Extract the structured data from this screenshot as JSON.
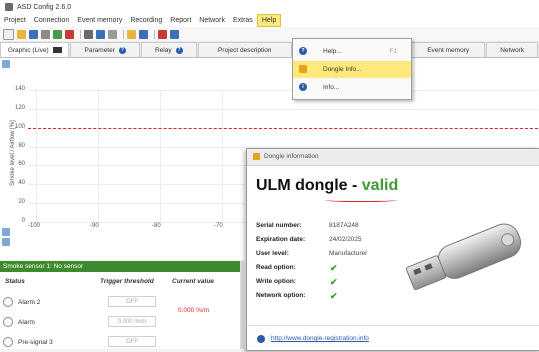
{
  "window": {
    "title": "ASD Config 2.6.0"
  },
  "menu": {
    "items": [
      "Project",
      "Connection",
      "Event memory",
      "Recording",
      "Report",
      "Network",
      "Extras",
      "Help"
    ],
    "active": "Help"
  },
  "tabs": [
    {
      "label": "Graphic (Live)"
    },
    {
      "label": "Parameter"
    },
    {
      "label": "Relay"
    },
    {
      "label": "Project description"
    },
    {
      "label": "Event memory"
    },
    {
      "label": "Network"
    }
  ],
  "help_menu": {
    "items": [
      {
        "label": "Help...",
        "shortcut": "F1"
      },
      {
        "label": "Dongle Info...",
        "shortcut": ""
      },
      {
        "label": "Info...",
        "shortcut": ""
      }
    ]
  },
  "chart_data": {
    "type": "line",
    "ylabel": "Smoke level / Airflow [%]",
    "y_ticks": [
      "140",
      "120",
      "100",
      "80",
      "60",
      "40",
      "20",
      "0"
    ],
    "x_ticks": [
      "-100",
      "-90",
      "-80",
      "-70"
    ],
    "ylim": [
      0,
      140
    ],
    "series": [
      {
        "name": "",
        "style": "dashed",
        "color": "#d62828",
        "values": [
          100,
          100
        ]
      }
    ]
  },
  "sensor": {
    "title": "Smoke sensor 1: No sensor",
    "headers": {
      "status": "Status",
      "trigger": "Trigger threshold",
      "current": "Current value"
    },
    "rows": [
      {
        "label": "Alarm 2",
        "threshold": "OFF"
      },
      {
        "label": "Alarm",
        "threshold": "0.000 %/m"
      },
      {
        "label": "Pre-signal 3",
        "threshold": "OFF"
      }
    ],
    "current_value": "0.000 %/m"
  },
  "dialog": {
    "title": "Dongle information",
    "heading_a": "ULM dongle - ",
    "heading_b": "valid",
    "fields": [
      {
        "key": "Serial number:",
        "value": "8187A248"
      },
      {
        "key": "Expiration date:",
        "value": "24/02/2025"
      },
      {
        "key": "User level:",
        "value": "Manufacturer"
      },
      {
        "key": "Read option:",
        "value": "✔"
      },
      {
        "key": "Write option:",
        "value": "✔"
      },
      {
        "key": "Network option:",
        "value": "✔"
      }
    ],
    "link": "http://www.dongle-registration.info"
  },
  "colors": {
    "accent_green": "#3f9a35",
    "threshold_red": "#d62828",
    "menu_highlight": "#ffe97a",
    "link_blue": "#2d5aa8"
  }
}
